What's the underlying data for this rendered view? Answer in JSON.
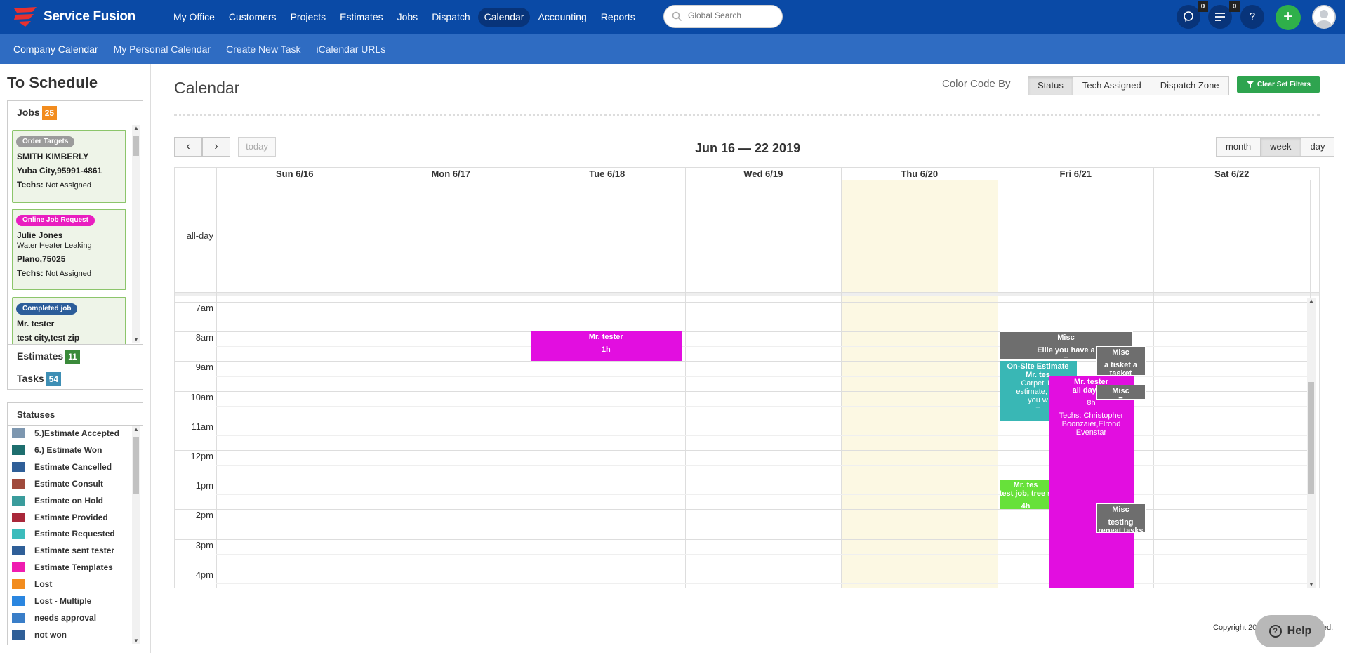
{
  "app": {
    "name": "Service Fusion",
    "brand_color": "#0a4aa6"
  },
  "topnav": [
    {
      "label": "My Office",
      "active": false
    },
    {
      "label": "Customers",
      "active": false
    },
    {
      "label": "Projects",
      "active": false
    },
    {
      "label": "Estimates",
      "active": false
    },
    {
      "label": "Jobs",
      "active": false
    },
    {
      "label": "Dispatch",
      "active": false
    },
    {
      "label": "Calendar",
      "active": true
    },
    {
      "label": "Accounting",
      "active": false
    },
    {
      "label": "Reports",
      "active": false
    }
  ],
  "search": {
    "placeholder": "Global Search"
  },
  "header_icons": {
    "chat": {
      "icon": "chat-icon",
      "badge": "0"
    },
    "list": {
      "icon": "list-icon",
      "badge": "0"
    },
    "help": {
      "icon": "question-icon",
      "label": "?"
    },
    "plus": {
      "icon": "plus-icon",
      "label": "+"
    },
    "avatar": {
      "icon": "avatar-icon"
    }
  },
  "subnav": [
    {
      "label": "Company Calendar",
      "active": true
    },
    {
      "label": "My Personal Calendar",
      "active": false
    },
    {
      "label": "Create New Task",
      "active": false
    },
    {
      "label": "iCalendar URLs",
      "active": false
    }
  ],
  "sidebar": {
    "title": "To Schedule",
    "jobs": {
      "label": "Jobs",
      "count": "25",
      "color": "#f28c1e"
    },
    "estimates": {
      "label": "Estimates",
      "count": "11",
      "color": "#3a8a3a"
    },
    "tasks": {
      "label": "Tasks",
      "count": "54",
      "color": "#3e8fb5"
    },
    "job_cards": [
      {
        "tag": "Order Targets",
        "tag_color": "#9b9b9b",
        "name": "SMITH KIMBERLY",
        "desc": "",
        "location": "Yuba City,95991-4861",
        "techs_label": "Techs:",
        "techs": "Not Assigned"
      },
      {
        "tag": "Online Job Request",
        "tag_color": "#e91ec0",
        "name": "Julie Jones",
        "desc": "Water Heater Leaking",
        "location": "Plano,75025",
        "techs_label": "Techs:",
        "techs": "Not Assigned"
      },
      {
        "tag": "Completed job",
        "tag_color": "#2c5d9a",
        "name": "Mr. tester",
        "desc": "",
        "location": "test city,test zip",
        "techs_label": "",
        "techs": ""
      }
    ],
    "statuses_title": "Statuses",
    "statuses": [
      {
        "label": "5.)Estimate Accepted",
        "color": "#7d97b0"
      },
      {
        "label": "6.) Estimate Won",
        "color": "#1d6e6e"
      },
      {
        "label": "Estimate Cancelled",
        "color": "#2f5f98"
      },
      {
        "label": "Estimate Consult",
        "color": "#a04a3c"
      },
      {
        "label": "Estimate on Hold",
        "color": "#3a9c9c"
      },
      {
        "label": "Estimate Provided",
        "color": "#a9283a"
      },
      {
        "label": "Estimate Requested",
        "color": "#3cbcbc"
      },
      {
        "label": "Estimate sent tester",
        "color": "#2f5f98"
      },
      {
        "label": "Estimate Templates",
        "color": "#ef1cb0"
      },
      {
        "label": "Lost",
        "color": "#f28c1e"
      },
      {
        "label": "Lost - Multiple",
        "color": "#2a86e0"
      },
      {
        "label": "needs approval",
        "color": "#3a7ec8"
      },
      {
        "label": "not won",
        "color": "#2f5f98"
      }
    ]
  },
  "calendar": {
    "title": "Calendar",
    "color_code_label": "Color Code By",
    "color_code_options": [
      {
        "label": "Status",
        "active": true
      },
      {
        "label": "Tech Assigned",
        "active": false
      },
      {
        "label": "Dispatch Zone",
        "active": false
      }
    ],
    "clear_filters": "Clear Set Filters",
    "prev": "‹",
    "next": "›",
    "today": "today",
    "range": "Jun 16 — 22 2019",
    "views": [
      {
        "label": "month",
        "active": false
      },
      {
        "label": "week",
        "active": true
      },
      {
        "label": "day",
        "active": false
      }
    ],
    "days": [
      "Sun 6/16",
      "Mon 6/17",
      "Tue 6/18",
      "Wed 6/19",
      "Thu 6/20",
      "Fri 6/21",
      "Sat 6/22"
    ],
    "today_index": 4,
    "allday_label": "all-day",
    "hours": [
      "7am",
      "8am",
      "9am",
      "10am",
      "11am",
      "12pm",
      "1pm",
      "2pm",
      "3pm",
      "4pm"
    ],
    "events": [
      {
        "day": 2,
        "start": 8,
        "end": 9,
        "title": "Mr. tester",
        "lines": [
          "",
          "1h"
        ],
        "color": "#e20ee0"
      },
      {
        "day": 5,
        "start": 8,
        "end": 8.95,
        "title": "Misc",
        "lines": [
          "",
          "Ellie you have a",
          "="
        ],
        "color": "#6e6e6e"
      },
      {
        "day": 5,
        "start": 8.5,
        "end": 9.5,
        "title": "Misc",
        "lines": [
          "",
          "a tisket a tasket",
          "="
        ],
        "color": "#6e6e6e"
      },
      {
        "day": 5,
        "start": 9,
        "end": 11,
        "title": "On-Site Estimate",
        "lines": [
          "Mr. tes",
          "Carpet 10",
          "estimate, tes",
          "you w",
          "="
        ],
        "color": "#39b7b5"
      },
      {
        "day": 5,
        "start": 9.5,
        "end": 17.5,
        "title": "Mr. tester",
        "lines": [
          "all day job",
          "",
          "8h",
          "",
          "Techs: Christopher Boonzaier,Elrond Evenstar"
        ],
        "color": "#e20ee0"
      },
      {
        "day": 5,
        "start": 9.8,
        "end": 10.3,
        "title": "Misc",
        "lines": [
          "="
        ],
        "color": "#6e6e6e"
      },
      {
        "day": 5,
        "start": 13,
        "end": 14,
        "title": "Mr. tes",
        "lines": [
          "test job, tree s",
          "",
          "4h"
        ],
        "color": "#67e13a"
      },
      {
        "day": 5,
        "start": 13.8,
        "end": 14.8,
        "title": "Misc",
        "lines": [
          "",
          "testing repeat tasks"
        ],
        "color": "#6e6e6e"
      }
    ]
  },
  "footer": {
    "copyright": "Copyright 2019. All rights reserved.",
    "help": "Help"
  }
}
